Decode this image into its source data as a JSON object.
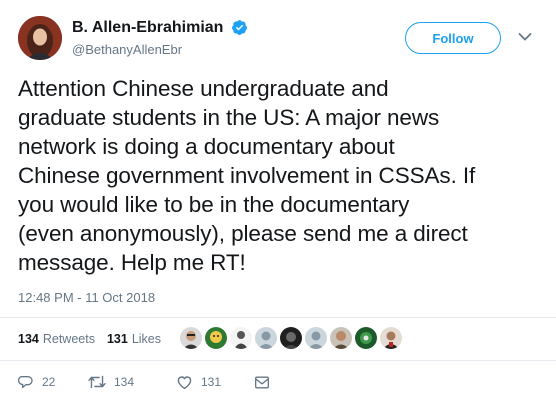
{
  "author": {
    "name": "B. Allen-Ebrahimian",
    "handle": "@BethanyAllenEbr"
  },
  "follow_label": "Follow",
  "tweet_text": "Attention Chinese undergraduate and\ngraduate students in the US: A major news\nnetwork is doing a documentary about\nChinese government involvement in CSSAs. If\nyou would like to be in the documentary\n(even anonymously), please send me a direct\nmessage. Help me RT!",
  "timestamp": "12:48 PM - 11 Oct 2018",
  "stats": {
    "retweets_count": "134",
    "retweets_label": "Retweets",
    "likes_count": "131",
    "likes_label": "Likes"
  },
  "liker_avatars": [
    "avatar-1",
    "avatar-2",
    "avatar-3",
    "avatar-4",
    "avatar-5",
    "avatar-6",
    "avatar-7",
    "avatar-8",
    "avatar-9"
  ],
  "actions": {
    "reply_count": "22",
    "retweet_count": "134",
    "like_count": "131"
  },
  "icons": [
    "verified-badge-icon",
    "chevron-down-icon",
    "reply-icon",
    "retweet-icon",
    "like-icon",
    "direct-message-icon"
  ],
  "colors": {
    "accent": "#1da1f2",
    "text": "#14171a",
    "secondary": "#657786",
    "divider": "#e6ecf0"
  }
}
